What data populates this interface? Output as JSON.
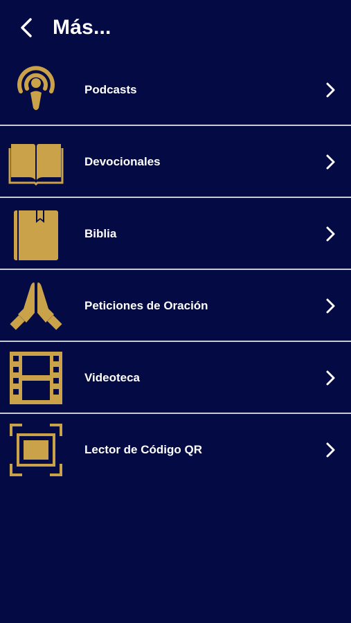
{
  "header": {
    "title": "Más...",
    "back_icon": "chevron-left-icon"
  },
  "colors": {
    "background": "#030a44",
    "accent": "#c9a24a",
    "divider": "#c9ccd8",
    "text": "#ffffff"
  },
  "menu": {
    "items": [
      {
        "label": "Podcasts",
        "icon": "podcast-icon"
      },
      {
        "label": "Devocionales",
        "icon": "open-book-icon"
      },
      {
        "label": "Biblia",
        "icon": "bible-bookmark-icon"
      },
      {
        "label": "Peticiones de Oración",
        "icon": "praying-hands-icon"
      },
      {
        "label": "Videoteca",
        "icon": "film-strip-icon"
      },
      {
        "label": "Lector de Código QR",
        "icon": "qr-scanner-icon"
      }
    ]
  }
}
